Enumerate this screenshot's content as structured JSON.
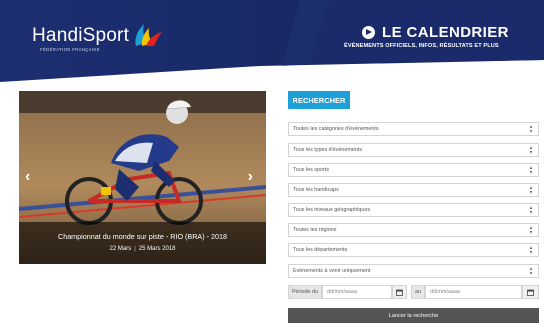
{
  "brand": {
    "name": "HandiSport",
    "subtitle": "FÉDÉRATION FRANÇAISE",
    "colors": {
      "navy": "#1a2a6a",
      "blue": "#1d9fd8",
      "red": "#e3231b",
      "yellow": "#f5c400"
    }
  },
  "calendar": {
    "title": "LE CALENDRIER",
    "subtitle": "ÉVÉNEMENTS OFFICIELS, INFOS, RÉSULTATS ET PLUS",
    "icon": "arrow-circle-icon"
  },
  "slider": {
    "title": "Championnat du monde sur piste - RIO (BRA) - 2018",
    "date_start": "22 Mars",
    "date_sep": "|",
    "date_end": "25 Mars 2018",
    "prev_icon": "chevron-left-icon",
    "next_icon": "chevron-right-icon"
  },
  "search": {
    "button_label": "RECHERCHER",
    "selects": [
      "Toutes les catégories d'événements",
      "Tous les types d'événements",
      "Tous les sports",
      "Tous les handicaps",
      "Tous les niveaux géographiques",
      "Toutes les régions",
      "Tous les départements",
      "Evénements à venir uniquement"
    ],
    "period_label": "Période du",
    "period_to_label": "au",
    "date_placeholder": "dd/mm/aaaa",
    "launch_label": "Lancer la recherche"
  }
}
